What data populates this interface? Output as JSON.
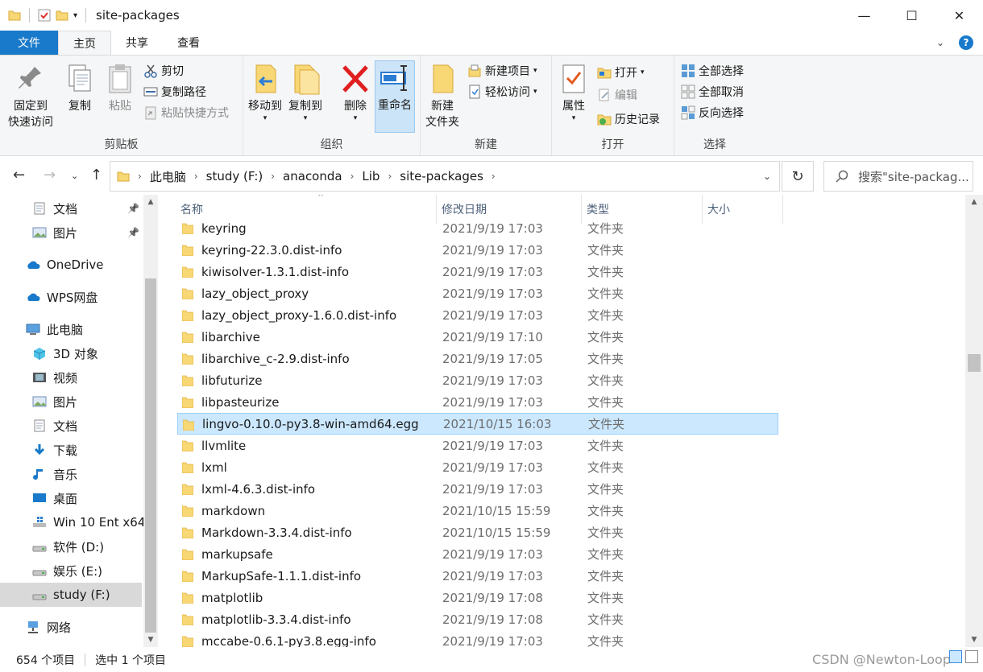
{
  "window": {
    "title": "site-packages"
  },
  "tabs": [
    {
      "label": "文件"
    },
    {
      "label": "主页"
    },
    {
      "label": "共享"
    },
    {
      "label": "查看"
    }
  ],
  "ribbon": {
    "clipboard": {
      "label": "剪贴板",
      "pin_line1": "固定到",
      "pin_line2": "快速访问",
      "copy": "复制",
      "paste": "粘贴",
      "cut": "剪切",
      "copy_path": "复制路径",
      "paste_shortcut": "粘贴快捷方式"
    },
    "organize": {
      "label": "组织",
      "move_to": "移动到",
      "copy_to": "复制到",
      "delete": "删除",
      "rename": "重命名"
    },
    "new": {
      "label": "新建",
      "new_folder_line1": "新建",
      "new_folder_line2": "文件夹",
      "new_item": "新建项目",
      "easy_access": "轻松访问"
    },
    "open": {
      "label": "打开",
      "properties": "属性",
      "open": "打开",
      "edit": "编辑",
      "history": "历史记录"
    },
    "select": {
      "label": "选择",
      "select_all": "全部选择",
      "select_none": "全部取消",
      "invert": "反向选择"
    }
  },
  "address": {
    "crumbs": [
      "此电脑",
      "study (F:)",
      "anaconda",
      "Lib",
      "site-packages"
    ],
    "search_placeholder": "搜索\"site-packag..."
  },
  "navpane": {
    "items": [
      {
        "label": "文档",
        "icon": "document-icon",
        "pinned": true
      },
      {
        "label": "图片",
        "icon": "picture-icon",
        "pinned": true
      },
      {
        "label": "OneDrive",
        "icon": "cloud-icon"
      },
      {
        "label": "WPS网盘",
        "icon": "cloud-icon"
      },
      {
        "label": "此电脑",
        "icon": "computer-icon"
      },
      {
        "label": "3D 对象",
        "icon": "cube-icon"
      },
      {
        "label": "视频",
        "icon": "video-icon"
      },
      {
        "label": "图片",
        "icon": "picture-icon"
      },
      {
        "label": "文档",
        "icon": "document-icon"
      },
      {
        "label": "下载",
        "icon": "download-icon"
      },
      {
        "label": "音乐",
        "icon": "music-icon"
      },
      {
        "label": "桌面",
        "icon": "desktop-icon"
      },
      {
        "label": "Win 10 Ent x64",
        "icon": "windows-drive-icon"
      },
      {
        "label": "软件 (D:)",
        "icon": "drive-icon"
      },
      {
        "label": "娱乐 (E:)",
        "icon": "drive-icon"
      },
      {
        "label": "study (F:)",
        "icon": "drive-icon",
        "selected": true
      },
      {
        "label": "网络",
        "icon": "network-icon"
      }
    ]
  },
  "columns": {
    "name": "名称",
    "date": "修改日期",
    "type": "类型",
    "size": "大小"
  },
  "files": [
    {
      "name": "keyring",
      "date": "2021/9/19 17:03",
      "type": "文件夹"
    },
    {
      "name": "keyring-22.3.0.dist-info",
      "date": "2021/9/19 17:03",
      "type": "文件夹"
    },
    {
      "name": "kiwisolver-1.3.1.dist-info",
      "date": "2021/9/19 17:03",
      "type": "文件夹"
    },
    {
      "name": "lazy_object_proxy",
      "date": "2021/9/19 17:03",
      "type": "文件夹"
    },
    {
      "name": "lazy_object_proxy-1.6.0.dist-info",
      "date": "2021/9/19 17:03",
      "type": "文件夹"
    },
    {
      "name": "libarchive",
      "date": "2021/9/19 17:10",
      "type": "文件夹"
    },
    {
      "name": "libarchive_c-2.9.dist-info",
      "date": "2021/9/19 17:05",
      "type": "文件夹"
    },
    {
      "name": "libfuturize",
      "date": "2021/9/19 17:03",
      "type": "文件夹"
    },
    {
      "name": "libpasteurize",
      "date": "2021/9/19 17:03",
      "type": "文件夹"
    },
    {
      "name": "lingvo-0.10.0-py3.8-win-amd64.egg",
      "date": "2021/10/15 16:03",
      "type": "文件夹",
      "selected": true
    },
    {
      "name": "llvmlite",
      "date": "2021/9/19 17:03",
      "type": "文件夹"
    },
    {
      "name": "lxml",
      "date": "2021/9/19 17:03",
      "type": "文件夹"
    },
    {
      "name": "lxml-4.6.3.dist-info",
      "date": "2021/9/19 17:03",
      "type": "文件夹"
    },
    {
      "name": "markdown",
      "date": "2021/10/15 15:59",
      "type": "文件夹"
    },
    {
      "name": "Markdown-3.3.4.dist-info",
      "date": "2021/10/15 15:59",
      "type": "文件夹"
    },
    {
      "name": "markupsafe",
      "date": "2021/9/19 17:03",
      "type": "文件夹"
    },
    {
      "name": "MarkupSafe-1.1.1.dist-info",
      "date": "2021/9/19 17:03",
      "type": "文件夹"
    },
    {
      "name": "matplotlib",
      "date": "2021/9/19 17:08",
      "type": "文件夹"
    },
    {
      "name": "matplotlib-3.3.4.dist-info",
      "date": "2021/9/19 17:08",
      "type": "文件夹"
    },
    {
      "name": "mccabe-0.6.1-py3.8.egg-info",
      "date": "2021/9/19 17:03",
      "type": "文件夹"
    }
  ],
  "status": {
    "count": "654 个项目",
    "selection": "选中 1 个项目"
  },
  "watermark": "CSDN @Newton-Loop",
  "colors": {
    "accent": "#1979ca",
    "selection": "#cce8ff",
    "folder": "#f8d775"
  }
}
